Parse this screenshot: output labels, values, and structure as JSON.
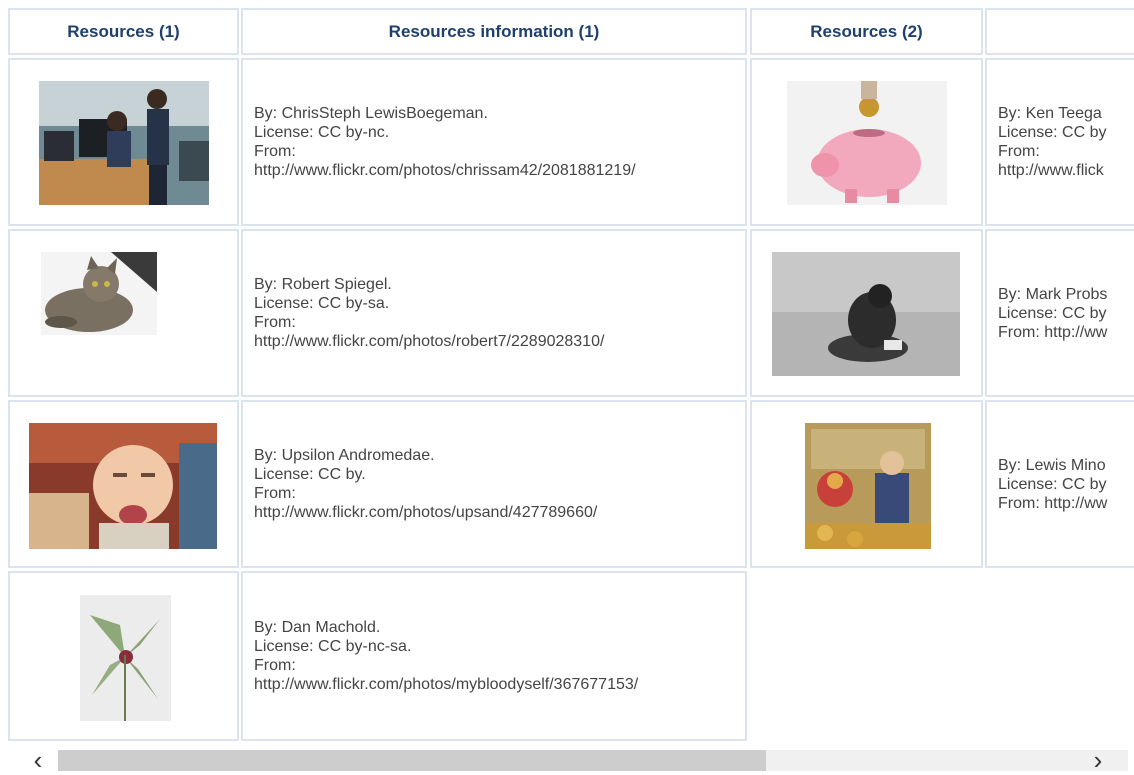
{
  "headers": [
    "Resources (1)",
    "Resources information (1)",
    "Resources (2)",
    ""
  ],
  "rows": [
    {
      "left": {
        "image": "office-photo",
        "by": "By: ChrisSteph LewisBoegeman.",
        "license": "License: CC by-nc.",
        "from": "From:",
        "url": "http://www.flickr.com/photos/chrissam42/2081881219/"
      },
      "right": {
        "image": "piggy-bank-photo",
        "by": "By: Ken Teega",
        "license": "License: CC by",
        "from": "From:",
        "url": "http://www.flick"
      }
    },
    {
      "left": {
        "image": "cat-photo",
        "by": "By: Robert Spiegel.",
        "license": "License: CC by-sa.",
        "from": "From:",
        "url": "http://www.flickr.com/photos/robert7/2289028310/"
      },
      "right": {
        "image": "sad-person-photo",
        "by": "By: Mark Probs",
        "license": "License: CC by",
        "from": "From: http://ww"
      }
    },
    {
      "left": {
        "image": "crying-baby-photo",
        "by": "By: Upsilon Andromedae.",
        "license": "License: CC by.",
        "from": "From:",
        "url": "http://www.flickr.com/photos/upsand/427789660/"
      },
      "right": {
        "image": "collage-photo",
        "by": "By: Lewis Mino",
        "license": "License: CC by",
        "from": "From: http://ww"
      }
    },
    {
      "left": {
        "image": "money-flower-photo",
        "by": "By: Dan Machold.",
        "license": "License: CC by-nc-sa.",
        "from": "From:",
        "url": "http://www.flickr.com/photos/mybloodyself/367677153/"
      }
    }
  ],
  "scrollbar": {
    "left_arrow": "‹",
    "right_arrow": "›",
    "position": 0.66
  }
}
